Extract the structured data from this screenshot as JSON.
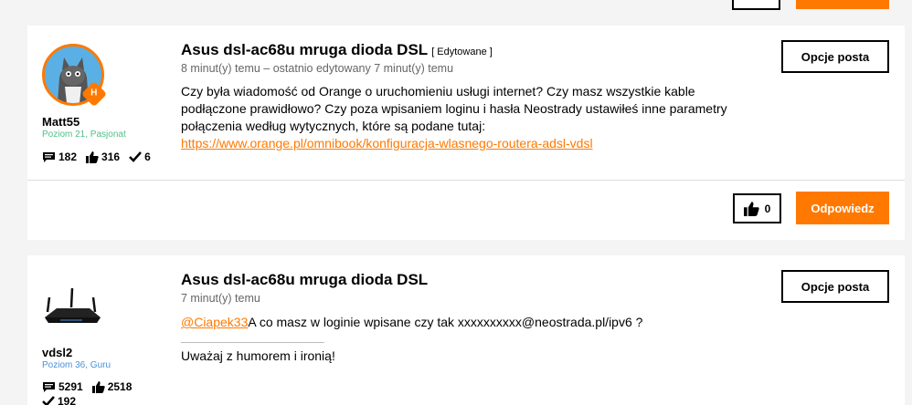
{
  "colors": {
    "accent": "#ff7900",
    "rank_green": "#50be87",
    "rank_blue": "#4a90d9"
  },
  "posts": [
    {
      "title": "Asus dsl-ac68u mruga dioda DSL",
      "edited_tag": "[ Edytowane ]",
      "meta": "8 minut(y) temu – ostatnio edytowany 7 minut(y) temu",
      "body": "Czy była wiadomość od Orange o uruchomieniu usługi internet? Czy masz wszystkie kable podłączone prawidłowo? Czy poza wpisaniem loginu i hasła Neostrady ustawiłeś inne parametry połączenia według wytycznych, które są podane tutaj:",
      "link": "https://www.orange.pl/omnibook/konfiguracja-wlasnego-routera-adsl-vdsl",
      "options_label": "Opcje posta",
      "kudos": "0",
      "reply_label": "Odpowiedz",
      "author": {
        "name": "Matt55",
        "rank": "Poziom 21, Pasjonat",
        "badge": "H",
        "messages": "182",
        "likes": "316",
        "solutions": "6"
      }
    },
    {
      "title": "Asus dsl-ac68u mruga dioda DSL",
      "meta": "7 minut(y) temu",
      "mention": "@Ciapek33",
      "body": "A co masz w loginie wpisane czy tak xxxxxxxxxx@neostrada.pl/ipv6 ?",
      "signature": "Uważaj z humorem i ironią!",
      "options_label": "Opcje posta",
      "author": {
        "name": "vdsl2",
        "rank": "Poziom 36, Guru",
        "messages": "5291",
        "likes": "2518",
        "solutions": "192"
      }
    }
  ]
}
